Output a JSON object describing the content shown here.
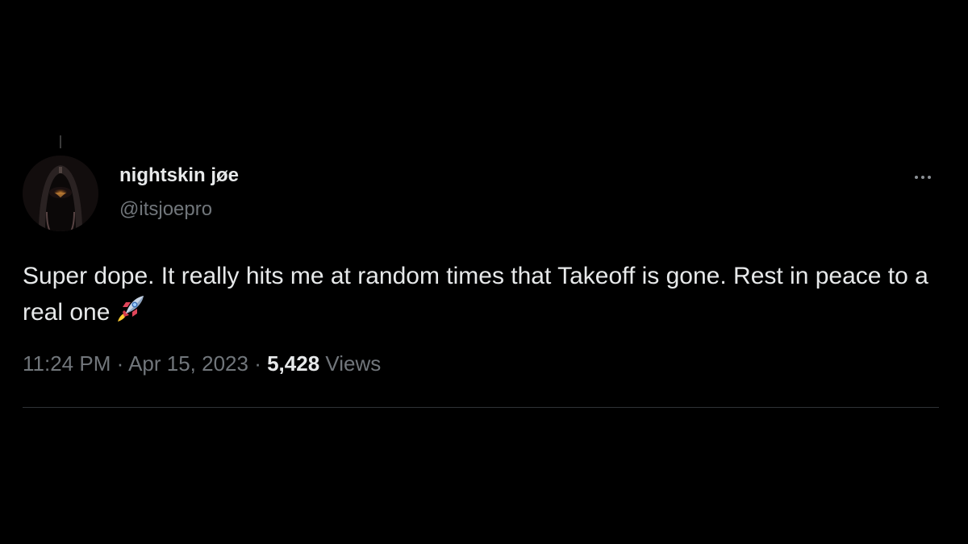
{
  "tweet": {
    "author": {
      "display_name": "nightskin jøe",
      "handle": "@itsjoepro",
      "avatar_icon": "profile-photo"
    },
    "text": "Super dope. It really hits me at random times that Takeoff is gone. Rest in peace to a real one",
    "emoji_icon": "rocket-emoji",
    "time": "11:24 PM",
    "separator": "·",
    "date": "Apr 15, 2023",
    "views_count": "5,428",
    "views_label": "Views",
    "more_icon": "more-options-icon"
  },
  "colors": {
    "background": "#000000",
    "primary_text": "#e7e9ea",
    "secondary_text": "#71767b",
    "divider": "#2f3336"
  }
}
